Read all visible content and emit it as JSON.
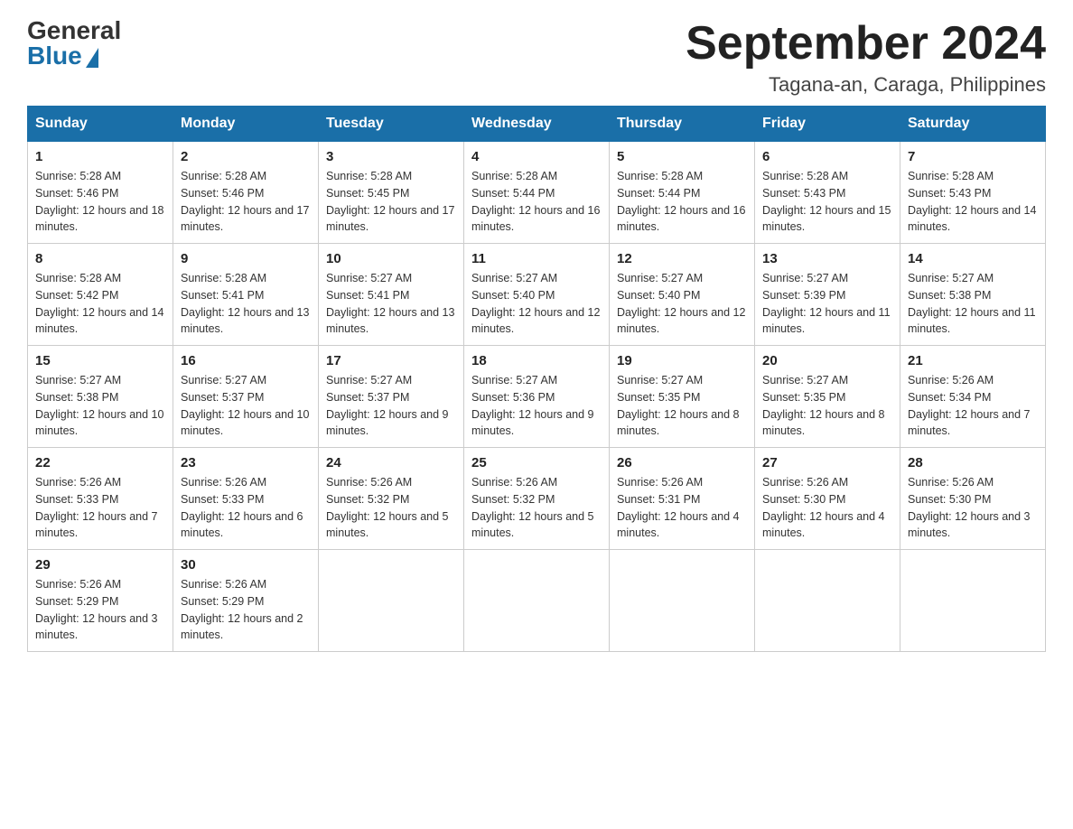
{
  "header": {
    "logo_general": "General",
    "logo_blue": "Blue",
    "month_title": "September 2024",
    "location": "Tagana-an, Caraga, Philippines"
  },
  "weekdays": [
    "Sunday",
    "Monday",
    "Tuesday",
    "Wednesday",
    "Thursday",
    "Friday",
    "Saturday"
  ],
  "weeks": [
    [
      {
        "day": "1",
        "sunrise": "5:28 AM",
        "sunset": "5:46 PM",
        "daylight": "12 hours and 18 minutes."
      },
      {
        "day": "2",
        "sunrise": "5:28 AM",
        "sunset": "5:46 PM",
        "daylight": "12 hours and 17 minutes."
      },
      {
        "day": "3",
        "sunrise": "5:28 AM",
        "sunset": "5:45 PM",
        "daylight": "12 hours and 17 minutes."
      },
      {
        "day": "4",
        "sunrise": "5:28 AM",
        "sunset": "5:44 PM",
        "daylight": "12 hours and 16 minutes."
      },
      {
        "day": "5",
        "sunrise": "5:28 AM",
        "sunset": "5:44 PM",
        "daylight": "12 hours and 16 minutes."
      },
      {
        "day": "6",
        "sunrise": "5:28 AM",
        "sunset": "5:43 PM",
        "daylight": "12 hours and 15 minutes."
      },
      {
        "day": "7",
        "sunrise": "5:28 AM",
        "sunset": "5:43 PM",
        "daylight": "12 hours and 14 minutes."
      }
    ],
    [
      {
        "day": "8",
        "sunrise": "5:28 AM",
        "sunset": "5:42 PM",
        "daylight": "12 hours and 14 minutes."
      },
      {
        "day": "9",
        "sunrise": "5:28 AM",
        "sunset": "5:41 PM",
        "daylight": "12 hours and 13 minutes."
      },
      {
        "day": "10",
        "sunrise": "5:27 AM",
        "sunset": "5:41 PM",
        "daylight": "12 hours and 13 minutes."
      },
      {
        "day": "11",
        "sunrise": "5:27 AM",
        "sunset": "5:40 PM",
        "daylight": "12 hours and 12 minutes."
      },
      {
        "day": "12",
        "sunrise": "5:27 AM",
        "sunset": "5:40 PM",
        "daylight": "12 hours and 12 minutes."
      },
      {
        "day": "13",
        "sunrise": "5:27 AM",
        "sunset": "5:39 PM",
        "daylight": "12 hours and 11 minutes."
      },
      {
        "day": "14",
        "sunrise": "5:27 AM",
        "sunset": "5:38 PM",
        "daylight": "12 hours and 11 minutes."
      }
    ],
    [
      {
        "day": "15",
        "sunrise": "5:27 AM",
        "sunset": "5:38 PM",
        "daylight": "12 hours and 10 minutes."
      },
      {
        "day": "16",
        "sunrise": "5:27 AM",
        "sunset": "5:37 PM",
        "daylight": "12 hours and 10 minutes."
      },
      {
        "day": "17",
        "sunrise": "5:27 AM",
        "sunset": "5:37 PM",
        "daylight": "12 hours and 9 minutes."
      },
      {
        "day": "18",
        "sunrise": "5:27 AM",
        "sunset": "5:36 PM",
        "daylight": "12 hours and 9 minutes."
      },
      {
        "day": "19",
        "sunrise": "5:27 AM",
        "sunset": "5:35 PM",
        "daylight": "12 hours and 8 minutes."
      },
      {
        "day": "20",
        "sunrise": "5:27 AM",
        "sunset": "5:35 PM",
        "daylight": "12 hours and 8 minutes."
      },
      {
        "day": "21",
        "sunrise": "5:26 AM",
        "sunset": "5:34 PM",
        "daylight": "12 hours and 7 minutes."
      }
    ],
    [
      {
        "day": "22",
        "sunrise": "5:26 AM",
        "sunset": "5:33 PM",
        "daylight": "12 hours and 7 minutes."
      },
      {
        "day": "23",
        "sunrise": "5:26 AM",
        "sunset": "5:33 PM",
        "daylight": "12 hours and 6 minutes."
      },
      {
        "day": "24",
        "sunrise": "5:26 AM",
        "sunset": "5:32 PM",
        "daylight": "12 hours and 5 minutes."
      },
      {
        "day": "25",
        "sunrise": "5:26 AM",
        "sunset": "5:32 PM",
        "daylight": "12 hours and 5 minutes."
      },
      {
        "day": "26",
        "sunrise": "5:26 AM",
        "sunset": "5:31 PM",
        "daylight": "12 hours and 4 minutes."
      },
      {
        "day": "27",
        "sunrise": "5:26 AM",
        "sunset": "5:30 PM",
        "daylight": "12 hours and 4 minutes."
      },
      {
        "day": "28",
        "sunrise": "5:26 AM",
        "sunset": "5:30 PM",
        "daylight": "12 hours and 3 minutes."
      }
    ],
    [
      {
        "day": "29",
        "sunrise": "5:26 AM",
        "sunset": "5:29 PM",
        "daylight": "12 hours and 3 minutes."
      },
      {
        "day": "30",
        "sunrise": "5:26 AM",
        "sunset": "5:29 PM",
        "daylight": "12 hours and 2 minutes."
      },
      null,
      null,
      null,
      null,
      null
    ]
  ]
}
